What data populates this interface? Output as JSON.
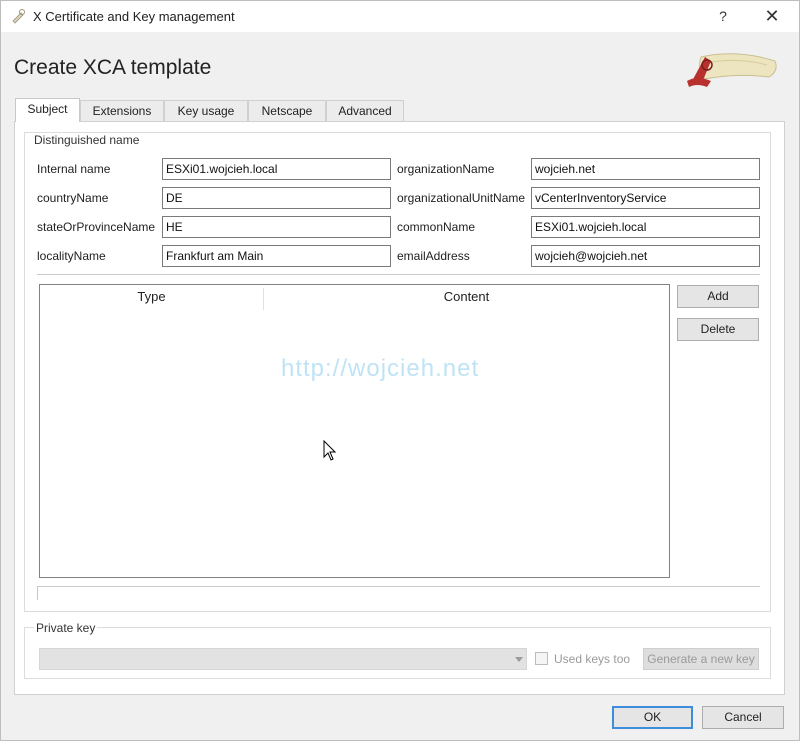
{
  "window": {
    "title": "X Certificate and Key management",
    "help_glyph": "?",
    "close_glyph": "✕"
  },
  "dialog": {
    "heading": "Create XCA template"
  },
  "tabs": [
    {
      "label": "Subject",
      "active": true
    },
    {
      "label": "Extensions",
      "active": false
    },
    {
      "label": "Key usage",
      "active": false
    },
    {
      "label": "Netscape",
      "active": false
    },
    {
      "label": "Advanced",
      "active": false
    }
  ],
  "distinguished_name": {
    "title": "Distinguished name",
    "left": [
      {
        "label": "Internal name",
        "value": "ESXi01.wojcieh.local"
      },
      {
        "label": "countryName",
        "value": "DE"
      },
      {
        "label": "stateOrProvinceName",
        "value": "HE"
      },
      {
        "label": "localityName",
        "value": "Frankfurt am Main"
      }
    ],
    "right": [
      {
        "label": "organizationName",
        "value": "wojcieh.net"
      },
      {
        "label": "organizationalUnitName",
        "value": "vCenterInventoryService"
      },
      {
        "label": "commonName",
        "value": "ESXi01.wojcieh.local"
      },
      {
        "label": "emailAddress",
        "value": "wojcieh@wojcieh.net"
      }
    ]
  },
  "extra_table": {
    "columns": [
      "Type",
      "Content"
    ],
    "watermark": "http://wojcieh.net",
    "add_label": "Add",
    "delete_label": "Delete"
  },
  "private_key": {
    "title": "Private key",
    "selected": "",
    "used_keys_label": "Used keys too",
    "used_keys_checked": false,
    "generate_label": "Generate a new key"
  },
  "footer": {
    "ok_label": "OK",
    "cancel_label": "Cancel"
  },
  "colors": {
    "accent_focus": "#3c8ddc",
    "watermark": "#bfe3f5",
    "logo_red": "#b8312f",
    "logo_cream": "#ece5bf"
  }
}
